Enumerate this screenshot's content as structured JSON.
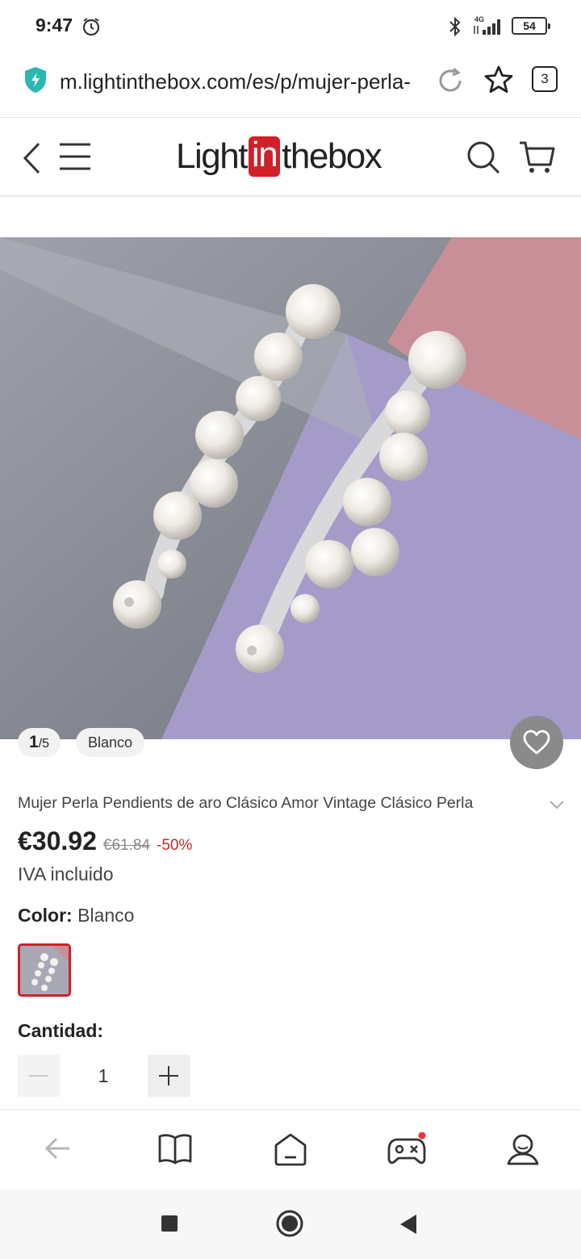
{
  "status_bar": {
    "time": "9:47",
    "network": "4G",
    "battery": "54"
  },
  "url_bar": {
    "url": "m.lightinthebox.com/es/p/mujer-perla-",
    "tabs_count": "3"
  },
  "header": {
    "logo_pre": "Light",
    "logo_in": "in",
    "logo_post": "thebox"
  },
  "gallery": {
    "current": "1",
    "total": "/5",
    "color_tag": "Blanco"
  },
  "product": {
    "title": "Mujer Perla Pendients de aro Clásico Amor Vintage Clásico Perla",
    "price": "€30.92",
    "old_price": "€61.84",
    "discount": "-50%",
    "vat": "IVA incluido",
    "color_label": "Color:",
    "color_value": "Blanco",
    "quantity_label": "Cantidad:",
    "quantity": "1"
  },
  "colors": {
    "accent": "#d0202a",
    "discount": "#c62a2a"
  },
  "browser_bar": {
    "icons": [
      "back-arrow-icon",
      "book-icon",
      "home-icon",
      "gamepad-icon",
      "profile-icon"
    ]
  },
  "nav_bar": {
    "icons": [
      "recents-square-icon",
      "home-circle-icon",
      "back-triangle-icon"
    ]
  }
}
